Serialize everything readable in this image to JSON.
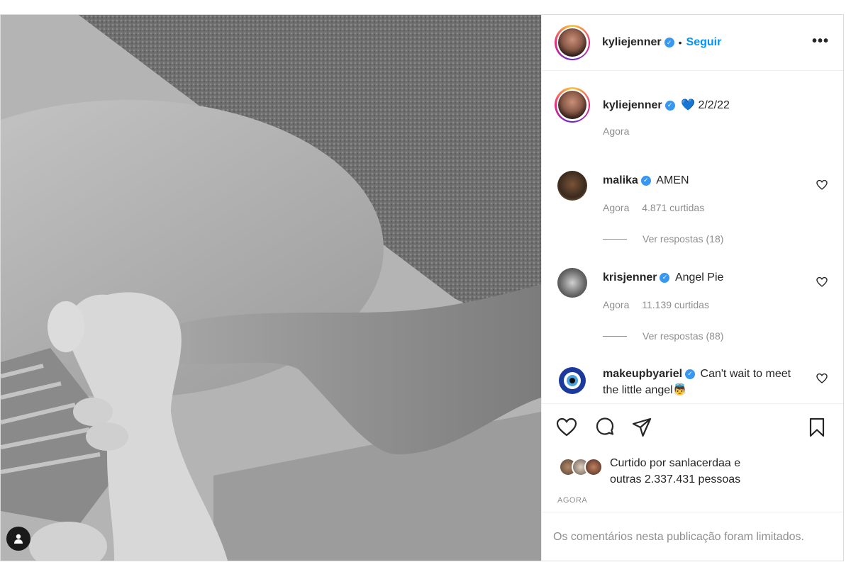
{
  "header": {
    "username": "kyliejenner",
    "separator": "•",
    "follow_label": "Seguir",
    "more_label": "•••"
  },
  "caption": {
    "username": "kyliejenner",
    "text": "2/2/22",
    "emoji": "💙",
    "time": "Agora"
  },
  "comments": [
    {
      "username": "malika",
      "text": "AMEN",
      "time": "Agora",
      "likes": "4.871 curtidas",
      "replies": "Ver respostas (18)"
    },
    {
      "username": "krisjenner",
      "text": "Angel Pie",
      "time": "Agora",
      "likes": "11.139 curtidas",
      "replies": "Ver respostas (88)"
    },
    {
      "username": "makeupbyariel",
      "text": "Can't wait to meet the little angel👼"
    }
  ],
  "likes": {
    "prefix": "Curtido por",
    "user": "sanlacerdaa",
    "connector": "e",
    "rest": "outras 2.337.431 pessoas"
  },
  "timestamp": "AGORA",
  "comments_limited": "Os comentários nesta publicação foram limitados.",
  "colors": {
    "link": "#0095f6",
    "verified": "#3897f0",
    "muted": "#8e8e8e",
    "border": "#dbdbdb"
  },
  "icons": [
    "user-tag-icon",
    "verified-icon",
    "more-icon",
    "heart-icon",
    "comment-icon",
    "share-icon",
    "bookmark-icon"
  ]
}
